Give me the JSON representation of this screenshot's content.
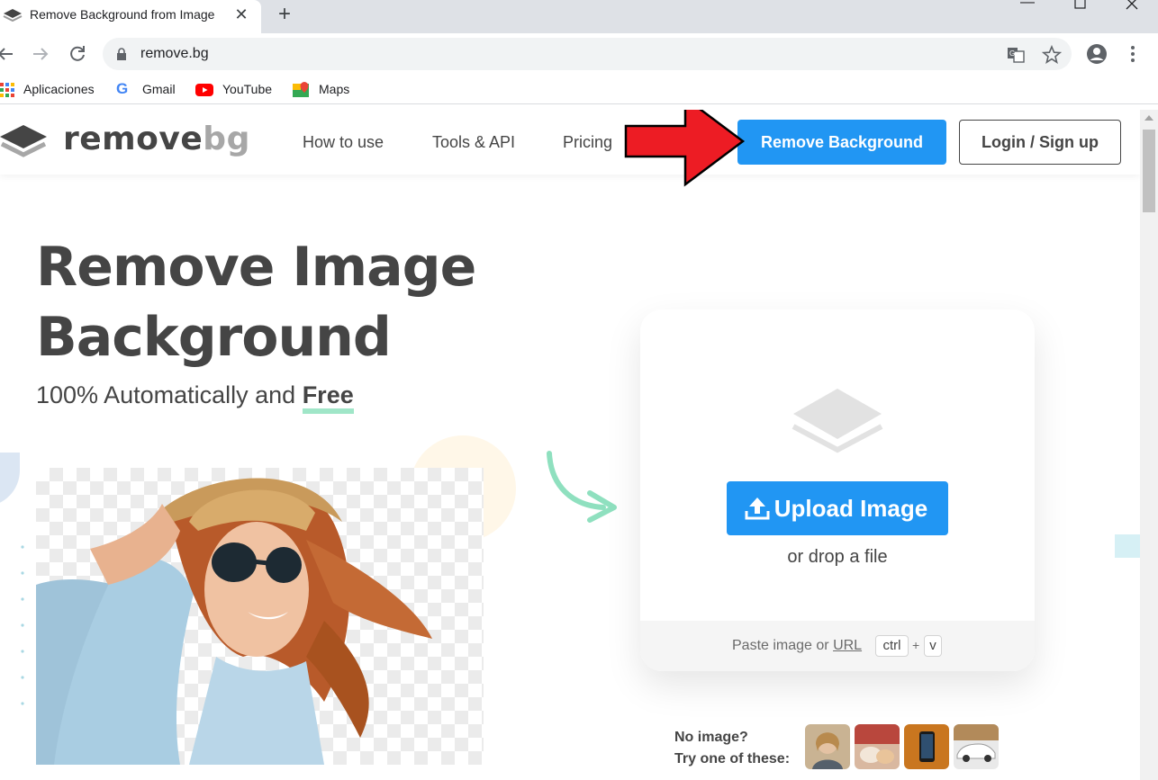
{
  "browser": {
    "tab_title": "Remove Background from Image",
    "new_tab": "+",
    "tab_close": "✕",
    "url": "remove.bg",
    "bookmarks": [
      "Aplicaciones",
      "Gmail",
      "YouTube",
      "Maps"
    ]
  },
  "site": {
    "brand_main": "remove",
    "brand_accent": "bg",
    "nav": [
      "How to use",
      "Tools & API",
      "Pricing"
    ],
    "cta_remove": "Remove Background",
    "cta_login": "Login / Sign up"
  },
  "hero": {
    "title_line1": "Remove Image",
    "title_line2": "Background",
    "subtitle_prefix": "100% Automatically and ",
    "subtitle_emphasis": "Free"
  },
  "upload": {
    "button_label": "Upload Image",
    "drop_text": "or drop a file",
    "paste_prefix": "Paste image or ",
    "paste_link": "URL",
    "key_ctrl": "ctrl",
    "key_plus": "+",
    "key_v": "v"
  },
  "samples": {
    "line1": "No image?",
    "line2": "Try one of these:"
  },
  "colors": {
    "accent_blue": "#2196f3",
    "annotation_red": "#ed1c24",
    "free_underline": "#a0e6c8"
  }
}
